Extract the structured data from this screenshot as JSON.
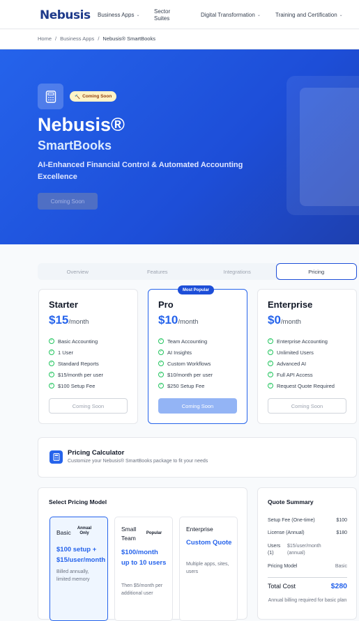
{
  "brand": {
    "logo_text": "Nebusis"
  },
  "nav": {
    "business_apps": "Business Apps",
    "sector_suites": "Sector Suites",
    "digital_transformation": "Digital Transformation",
    "training": "Training and Certification"
  },
  "breadcrumb": {
    "home": "Home",
    "sep": "/",
    "section": "Business Apps",
    "current": "Nebusis® SmartBooks"
  },
  "hero": {
    "badge": "Coming Soon",
    "title": "Nebusis®",
    "subtitle": "SmartBooks",
    "tagline": "AI-Enhanced Financial Control & Automated Accounting Excellence",
    "button": "Coming Soon"
  },
  "tabs": [
    "Overview",
    "Features",
    "Integrations",
    "Pricing"
  ],
  "plans": [
    {
      "name": "Starter",
      "price": "$15",
      "per": "/month",
      "features": [
        "Basic Accounting",
        "1 User",
        "Standard Reports",
        "$15/month per user",
        "$100 Setup Fee"
      ],
      "button": "Coming Soon"
    },
    {
      "name": "Pro",
      "price": "$10",
      "per": "/month",
      "badge": "Most Popular",
      "features": [
        "Team Accounting",
        "AI Insights",
        "Custom Workflows",
        "$10/month per user",
        "$250 Setup Fee"
      ],
      "button": "Coming Soon"
    },
    {
      "name": "Enterprise",
      "price": "$0",
      "per": "/month",
      "features": [
        "Enterprise Accounting",
        "Unlimited Users",
        "Advanced AI",
        "Full API Access",
        "Request Quote Required"
      ],
      "button": "Coming Soon"
    }
  ],
  "calculator": {
    "title": "Pricing Calculator",
    "subtitle": "Customize your Nebusis® SmartBooks package to fit your needs"
  },
  "model": {
    "title": "Select Pricing Model",
    "options": [
      {
        "name": "Basic",
        "tag": "Annual Only",
        "price": "$100 setup + $15/user/month",
        "note": "Billed annually, limited memory"
      },
      {
        "name": "Small Team",
        "tag": "Popular",
        "price": "$100/month up to 10 users",
        "note": "Then $5/month per additional user"
      },
      {
        "name": "Enterprise",
        "tag": "",
        "price": "Custom Quote",
        "note": "Multiple apps, sites, users"
      }
    ]
  },
  "quote": {
    "title": "Quote Summary",
    "rows": [
      {
        "label": "Setup Fee (One-time)",
        "value": "$100"
      },
      {
        "label": "License (Annual)",
        "value": "$180"
      },
      {
        "label": "Users (1)",
        "value": "$15/user/month (annual)"
      },
      {
        "label": "Pricing Model",
        "value": "Basic"
      }
    ],
    "total_label": "Total Cost",
    "total_value": "$280",
    "note": "Annual billing required for basic plan"
  }
}
